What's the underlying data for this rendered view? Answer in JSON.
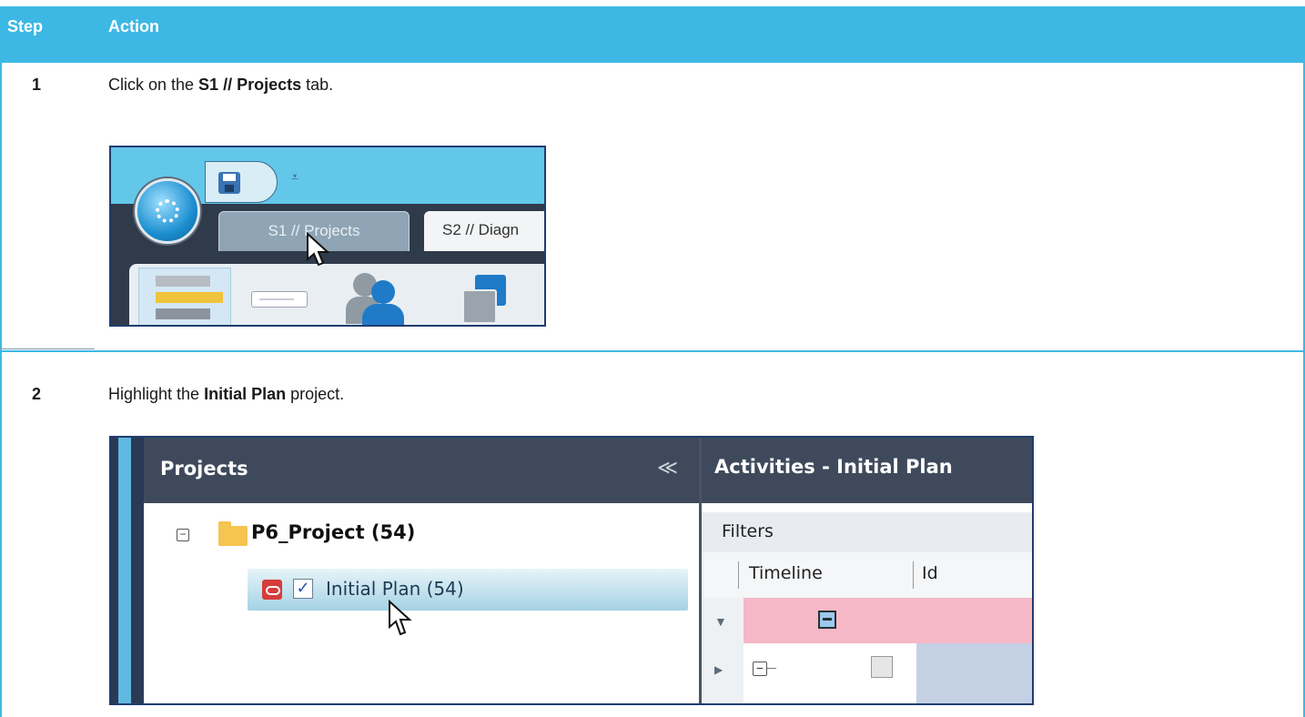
{
  "table": {
    "header": {
      "step": "Step",
      "action": "Action"
    },
    "rows": [
      {
        "step": "1",
        "text_pre": "Click on the ",
        "text_bold": "S1 // Projects",
        "text_post": " tab.",
        "screenshot": {
          "tab_active": "S1 // Projects",
          "tab_other": "S2 // Diagn",
          "qat_arrow": "⩡"
        }
      },
      {
        "step": "2",
        "text_pre": "Highlight the ",
        "text_bold": "Initial Plan",
        "text_post": " project.",
        "screenshot": {
          "projects_title": "Projects",
          "collapse_glyph": "≪",
          "tree_root": "P6_Project (54)",
          "tree_minus": "−",
          "selected_project": "Initial  Plan (54)",
          "check_glyph": "✓",
          "activities_title": "Activities - Initial  Plan",
          "filters_label": "Filters",
          "column_timeline": "Timeline",
          "column_id": "Id"
        }
      }
    ]
  },
  "colors": {
    "header_bg": "#3db8e5",
    "panel_header": "#3e4a5c",
    "filter_pink": "#f6b8c6"
  }
}
